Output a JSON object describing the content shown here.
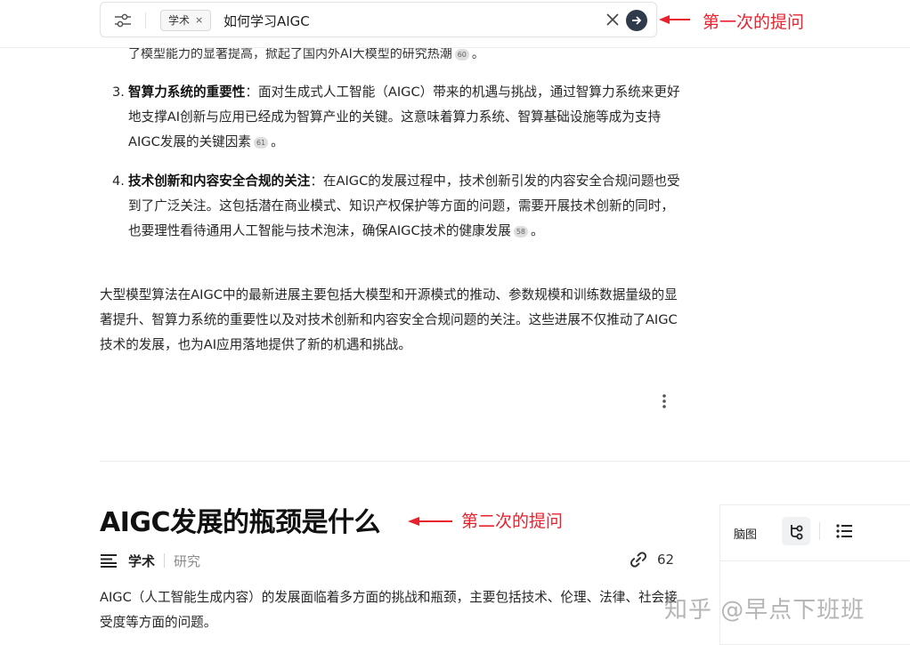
{
  "search": {
    "scope_chip": "学术",
    "chip_close": "×",
    "query": "如何学习AIGC"
  },
  "annotations": {
    "first": "第一次的提问",
    "second": "第二次的提问"
  },
  "answer1": {
    "cut_line": "了模型能力的显著提高，掀起了国内外AI大模型的研究热潮",
    "cut_line_cite": "60",
    "cut_line_end": "。",
    "items": [
      {
        "num": "3.",
        "title": "智算力系统的重要性",
        "text": "：面对生成式人工智能（AIGC）带来的机遇与挑战，通过智算力系统来更好地支撑AI创新与应用已经成为智算产业的关键。这意味着算力系统、智算基础设施等成为支持AIGC发展的关键因素",
        "cite": "61",
        "end": "。"
      },
      {
        "num": "4.",
        "title": "技术创新和内容安全合规的关注",
        "text": "：在AIGC的发展过程中，技术创新引发的内容安全合规问题也受到了广泛关注。这包括潜在商业模式、知识产权保护等方面的问题，需要开展技术创新的同时，也要理性看待通用人工智能与技术泡沫，确保AIGC技术的健康发展",
        "cite": "58",
        "end": "。"
      }
    ],
    "summary": "大型模型算法在AIGC中的最新进展主要包括大模型和开源模式的推动、参数规模和训练数据量级的显著提升、智算力系统的重要性以及对技术创新和内容安全合规问题的关注。这些进展不仅推动了AIGC技术的发展，也为AI应用落地提供了新的机遇和挑战。"
  },
  "question2": {
    "title": "AIGC发展的瓶颈是什么",
    "scope": "学术",
    "mode": "研究",
    "link_count": "62",
    "answer": "AIGC（人工智能生成内容）的发展面临着多方面的挑战和瓶颈，主要包括技术、伦理、法律、社会接受度等方面的问题。"
  },
  "side_panel": {
    "mindmap_label": "脑图"
  },
  "watermark": "知乎 @早点下班班",
  "colors": {
    "annotation": "#e8212c",
    "submit_button": "#2f3a4a",
    "citation_badge": "#dedede"
  },
  "icons": {
    "filter": "sliders-icon",
    "clear": "close-icon",
    "submit": "arrow-right-circle-icon",
    "more": "more-vertical-icon",
    "scope": "lines-icon",
    "link": "link-icon",
    "mindmap": "mindmap-icon",
    "list": "list-icon"
  }
}
